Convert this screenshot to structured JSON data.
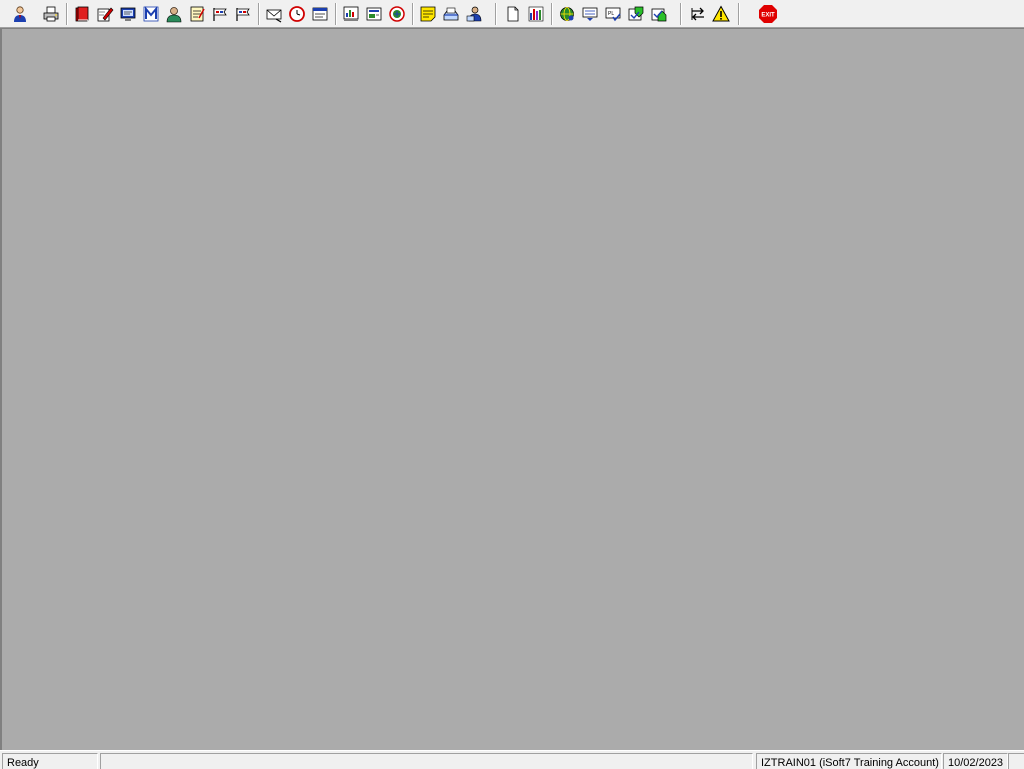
{
  "toolbar": {
    "buttons": [
      {
        "id": "user",
        "icon": "user-icon"
      },
      {
        "id": "print",
        "icon": "printer-icon"
      },
      {
        "id": "book",
        "icon": "book-icon"
      },
      {
        "id": "edit",
        "icon": "pencil-edit-icon"
      },
      {
        "id": "screen",
        "icon": "screen-icon"
      },
      {
        "id": "m",
        "icon": "letter-m-icon"
      },
      {
        "id": "person",
        "icon": "person-icon"
      },
      {
        "id": "notes",
        "icon": "notes-icon"
      },
      {
        "id": "flag1",
        "icon": "flag-icon"
      },
      {
        "id": "flag2",
        "icon": "flag-icon"
      },
      {
        "id": "envelope",
        "icon": "envelope-icon"
      },
      {
        "id": "clock",
        "icon": "clock-icon"
      },
      {
        "id": "window",
        "icon": "window-icon"
      },
      {
        "id": "chart-window",
        "icon": "chart-window-icon"
      },
      {
        "id": "card",
        "icon": "card-icon"
      },
      {
        "id": "globe",
        "icon": "globe-icon"
      },
      {
        "id": "note-yellow",
        "icon": "sticky-note-icon"
      },
      {
        "id": "tray",
        "icon": "tray-icon"
      },
      {
        "id": "people",
        "icon": "people-icon"
      },
      {
        "id": "blank-doc",
        "icon": "blank-document-icon"
      },
      {
        "id": "bar-chart",
        "icon": "bar-chart-icon"
      },
      {
        "id": "network",
        "icon": "network-icon"
      },
      {
        "id": "inbox",
        "icon": "inbox-icon"
      },
      {
        "id": "check-doc",
        "icon": "check-document-icon"
      },
      {
        "id": "green-down",
        "icon": "green-download-icon"
      },
      {
        "id": "green-up",
        "icon": "green-upload-icon"
      },
      {
        "id": "swap",
        "icon": "swap-icon"
      },
      {
        "id": "warning",
        "icon": "warning-icon"
      },
      {
        "id": "exit",
        "icon": "exit-icon",
        "label": "EXIT"
      }
    ]
  },
  "colors": {
    "workspace_bg": "#ababab",
    "chrome_bg": "#f0f0f0",
    "exit_red": "#e00000",
    "warning_yellow": "#ffe600"
  },
  "statusbar": {
    "status_text": "Ready",
    "middle_text": "",
    "account_text": "IZTRAIN01 (iSoft7 Training Account)",
    "date_text": "10/02/2023"
  }
}
